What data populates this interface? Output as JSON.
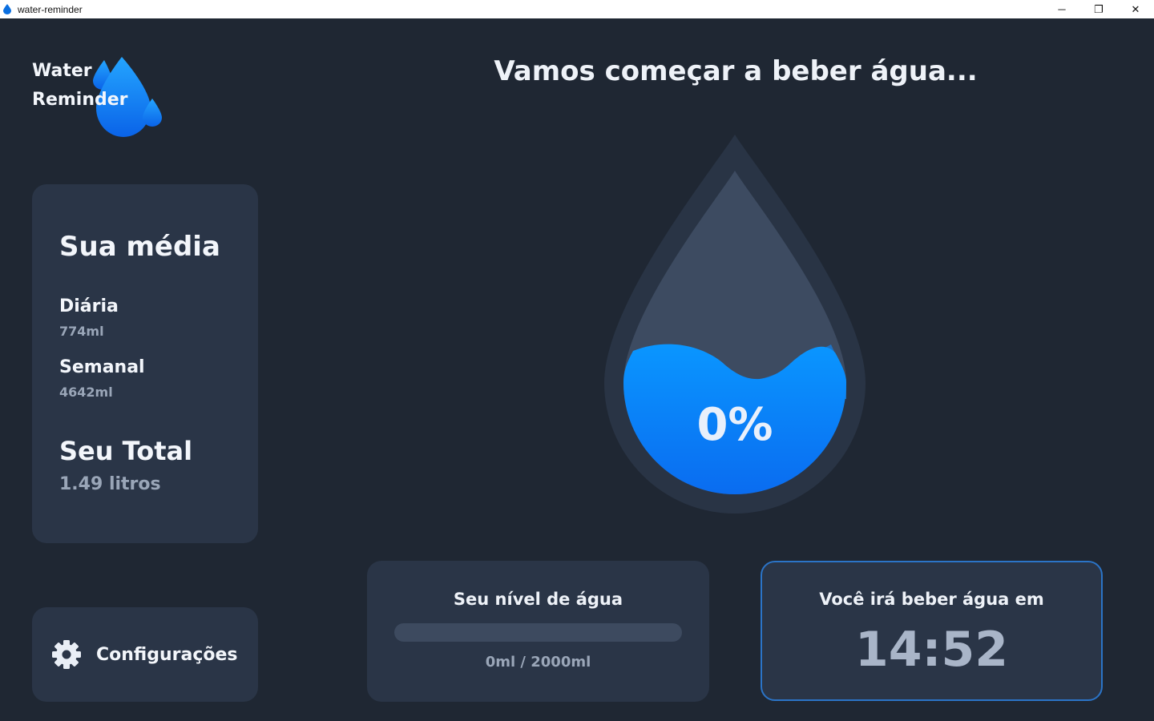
{
  "window": {
    "title": "water-reminder",
    "minimize_glyph": "─",
    "maximize_glyph": "❐",
    "close_glyph": "✕"
  },
  "logo": {
    "line1": "Water",
    "line2": "Reminder",
    "icon": "water-drop-icon"
  },
  "headline": "Vamos começar a beber água...",
  "average": {
    "title": "Sua média",
    "daily_label": "Diária",
    "daily_value": "774ml",
    "weekly_label": "Semanal",
    "weekly_value": "4642ml",
    "total_label": "Seu Total",
    "total_value": "1.49 litros"
  },
  "settings": {
    "label": "Configurações",
    "icon": "gear-icon"
  },
  "drop": {
    "percent_text": "0%",
    "fill_fraction": 0.0
  },
  "level": {
    "title": "Seu nível de água",
    "progress": 0,
    "text": "0ml / 2000ml"
  },
  "timer": {
    "title": "Você irá beber água em",
    "value": "14:52"
  },
  "colors": {
    "background": "#1f2733",
    "card": "#2a3547",
    "accent": "#0a84ff",
    "timer_border": "#2b74c7"
  }
}
